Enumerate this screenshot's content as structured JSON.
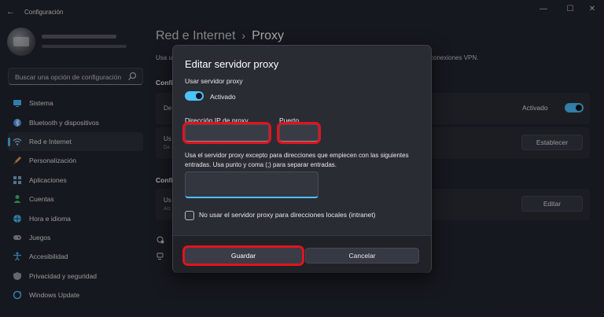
{
  "window": {
    "title": "Configuración",
    "back_glyph": "←",
    "minimize_glyph": "—",
    "maximize_glyph": "☐",
    "close_glyph": "✕"
  },
  "sidebar": {
    "search_placeholder": "Buscar una opción de configuración",
    "items": [
      {
        "label": "Sistema",
        "icon": "monitor-icon",
        "color": "#4cc2ff"
      },
      {
        "label": "Bluetooth y dispositivos",
        "icon": "bluetooth-icon",
        "color": "#4c9fff"
      },
      {
        "label": "Red e Internet",
        "icon": "wifi-icon",
        "color": "#9ec9ff",
        "active": true
      },
      {
        "label": "Personalización",
        "icon": "brush-icon",
        "color": "#f0a35a"
      },
      {
        "label": "Aplicaciones",
        "icon": "apps-icon",
        "color": "#7fb0d6"
      },
      {
        "label": "Cuentas",
        "icon": "person-icon",
        "color": "#4cc27a"
      },
      {
        "label": "Hora e idioma",
        "icon": "globe-icon",
        "color": "#4cc2ff"
      },
      {
        "label": "Juegos",
        "icon": "gamepad-icon",
        "color": "#a0a4ad"
      },
      {
        "label": "Accesibilidad",
        "icon": "accessibility-icon",
        "color": "#4cc2ff"
      },
      {
        "label": "Privacidad y seguridad",
        "icon": "shield-icon",
        "color": "#9aa0a8"
      },
      {
        "label": "Windows Update",
        "icon": "update-icon",
        "color": "#4cc2ff"
      }
    ]
  },
  "main": {
    "breadcrumb_parent": "Red e Internet",
    "breadcrumb_sep": "›",
    "breadcrumb_current": "Proxy",
    "description_left": "Usa u",
    "description_right": "conexiones VPN.",
    "section1_head": "Confi",
    "card1_text": "De",
    "card1_status": "Activado",
    "card2_text": "Us",
    "card2_sub": "De",
    "card2_button": "Establecer",
    "section2_head": "Confi",
    "card3_text": "Us",
    "card3_sub": "Act",
    "card3_button": "Editar"
  },
  "dialog": {
    "title": "Editar servidor proxy",
    "use_proxy_label": "Usar servidor proxy",
    "toggle_label": "Activado",
    "ip_label": "Dirección IP de proxy",
    "ip_value": "",
    "port_label": "Puerto",
    "port_value": "",
    "exceptions_text": "Usa el servidor proxy excepto para direcciones que empiecen con las siguientes entradas. Usa punto y coma (;) para separar entradas.",
    "exceptions_value": "",
    "local_checkbox_label": "No usar el servidor proxy para direcciones locales (intranet)",
    "save_label": "Guardar",
    "cancel_label": "Cancelar"
  },
  "colors": {
    "accent": "#4cc2ff",
    "highlight": "#e0141e"
  }
}
